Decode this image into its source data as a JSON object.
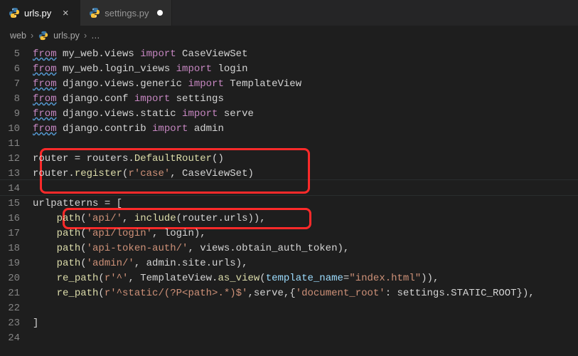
{
  "tabs": [
    {
      "name": "urls.py",
      "active": true
    },
    {
      "name": "settings.py",
      "active": false
    }
  ],
  "breadcrumb": {
    "root": "web",
    "file": "urls.py",
    "more": "…"
  },
  "lines": {
    "5": {
      "t": "from my_web.views import CaseViewSet"
    },
    "6": {
      "t": "from my_web.login_views import login"
    },
    "7": {
      "t": "from django.views.generic import TemplateView"
    },
    "8": {
      "t": "from django.conf import settings"
    },
    "9": {
      "t": "from django.views.static import serve"
    },
    "10": {
      "t": "from django.contrib import admin"
    },
    "11": {
      "t": ""
    },
    "12": {
      "t": "router = routers.DefaultRouter()"
    },
    "13": {
      "t": "router.register(r'case', CaseViewSet)"
    },
    "14": {
      "t": ""
    },
    "15": {
      "t": "urlpatterns = ["
    },
    "16": {
      "t": "    path('api/', include(router.urls)),"
    },
    "17": {
      "t": "    path('api/login', login),"
    },
    "18": {
      "t": "    path('api-token-auth/', views.obtain_auth_token),"
    },
    "19": {
      "t": "    path('admin/', admin.site.urls),"
    },
    "20": {
      "t": "    re_path(r'^', TemplateView.as_view(template_name=\"index.html\")),"
    },
    "21": {
      "t": "    re_path(r'^static/(?P<path>.*)$',serve,{'document_root': settings.STATIC_ROOT}),"
    },
    "22": {
      "t": ""
    },
    "23": {
      "t": "]"
    },
    "24": {
      "t": ""
    }
  }
}
